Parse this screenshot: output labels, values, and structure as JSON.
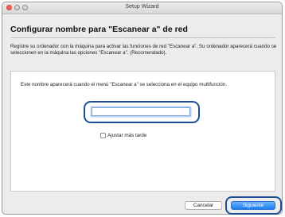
{
  "window": {
    "title": "Setup Wizard"
  },
  "page": {
    "heading": "Configurar nombre para \"Escanear a\" de red",
    "description": "Registre su ordenador con la máquina para activar  las funciones de red \"Escanear a\". Su ordenador aparecerá cuando se seleccionen en la máquina las opciones \"Escanear a\". (Recomendado)."
  },
  "panel": {
    "text": "Este nombre aparecerá cuando el menú \"Escanear a\" se selecciona en el equipo multifunción.",
    "name_input_value": "",
    "checkbox_label": "Ajustar más tarde",
    "checkbox_checked": false
  },
  "footer": {
    "cancel_label": "Cancelar",
    "next_label": "Siguiente"
  },
  "colors": {
    "highlight_outline": "#1e4f96",
    "primary_button": "#1a7ef2",
    "close_light": "#fc5f57"
  }
}
